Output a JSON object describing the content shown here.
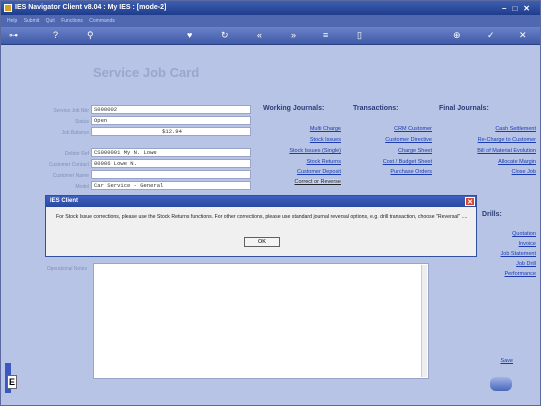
{
  "titlebar": {
    "title": "IES Navigator Client v8.04 : My IES : [mode-2]"
  },
  "menubar": {
    "items": [
      "Help",
      "Submit",
      "Quit",
      "Functions",
      "Commands"
    ]
  },
  "form": {
    "title": "Service Job Card",
    "fields": [
      {
        "label": "Service Job Nbr",
        "value": "S000002"
      },
      {
        "label": "Status",
        "value": "Open"
      },
      {
        "label": "Job Balance",
        "value": "$12.94"
      },
      {
        "label": "Debtor Ref",
        "value": "CS000001 My N. Lowe"
      },
      {
        "label": "Customer Contact",
        "value": "00006 Lowe N."
      },
      {
        "label": "Customer Name",
        "value": ""
      },
      {
        "label": "Model",
        "value": "Car Service - General"
      }
    ],
    "operational_notes_label": "Operational Notes"
  },
  "working_journals": {
    "heading": "Working Journals:",
    "links": [
      "Multi Charge",
      "Stock Issues",
      "Stock Issues (Single)",
      "Stock Returns",
      "Customer Deposit",
      "Correct or Reverse"
    ]
  },
  "transactions": {
    "heading": "Transactions:",
    "links": [
      "CRM Customer",
      "Customer Directive",
      "Charge Sheet",
      "Cost / Budget Sheet",
      "Purchase Orders"
    ]
  },
  "final_journals": {
    "heading": "Final Journals:",
    "links": [
      "Cash Settlement",
      "Re-Charge to Customer",
      "Bill of Material Evolution",
      "Allocate Margin",
      "Close Job"
    ]
  },
  "drills": {
    "heading": "Drills:",
    "links": [
      "Quotation",
      "Invoice",
      "Job Statement",
      "Job Drill",
      "Performance"
    ]
  },
  "save": {
    "label": "Save"
  },
  "dialog": {
    "title": "IES Client",
    "message": "For Stock Issue corrections, please use the Stock Returns functions. For other corrections, please use standard journal reversal options, e.g. drill transaction, choose \"Reversal\" ....",
    "ok_label": "OK"
  }
}
